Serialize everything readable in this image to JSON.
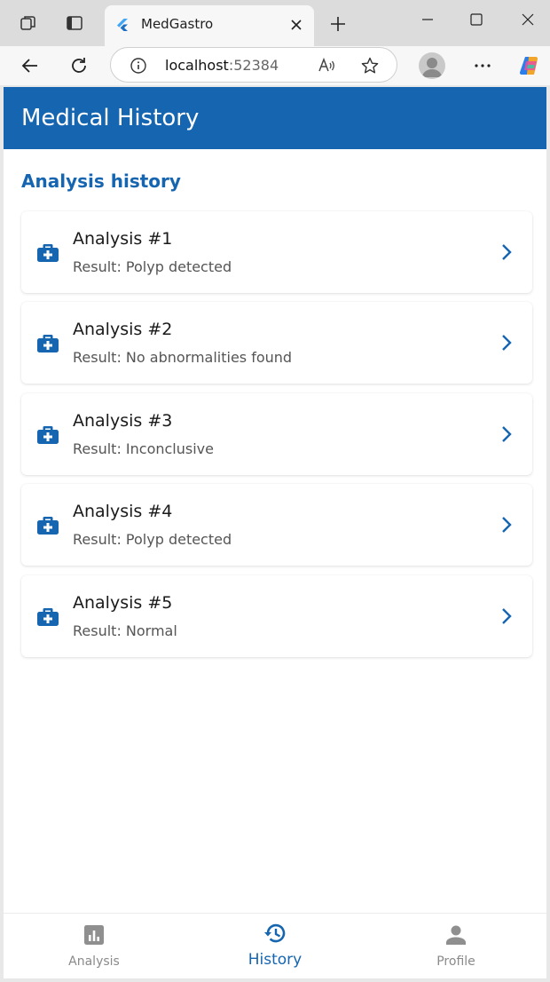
{
  "browser": {
    "tab_title": "MedGastro",
    "url_host": "localhost",
    "url_port": ":52384",
    "icons": [
      "workspaces-icon",
      "tab-actions-icon",
      "flutter-favicon",
      "close-tab-icon",
      "new-tab-icon",
      "minimize-icon",
      "maximize-icon",
      "close-window-icon",
      "back-icon",
      "reload-icon",
      "site-info-icon",
      "read-aloud-icon",
      "favorite-star-icon",
      "profile-avatar",
      "more-menu-icon",
      "copilot-icon"
    ]
  },
  "app": {
    "title": "Medical History",
    "section_title": "Analysis history",
    "accent_color": "#1565b0",
    "items": [
      {
        "title": "Analysis #1",
        "result": "Result: Polyp detected"
      },
      {
        "title": "Analysis #2",
        "result": "Result: No abnormalities found"
      },
      {
        "title": "Analysis #3",
        "result": "Result: Inconclusive"
      },
      {
        "title": "Analysis #4",
        "result": "Result: Polyp detected"
      },
      {
        "title": "Analysis #5",
        "result": "Result: Normal"
      }
    ],
    "bottom_nav": [
      {
        "label": "Analysis",
        "icon": "bar-chart-icon",
        "selected": false
      },
      {
        "label": "History",
        "icon": "history-icon",
        "selected": true
      },
      {
        "label": "Profile",
        "icon": "person-icon",
        "selected": false
      }
    ]
  }
}
